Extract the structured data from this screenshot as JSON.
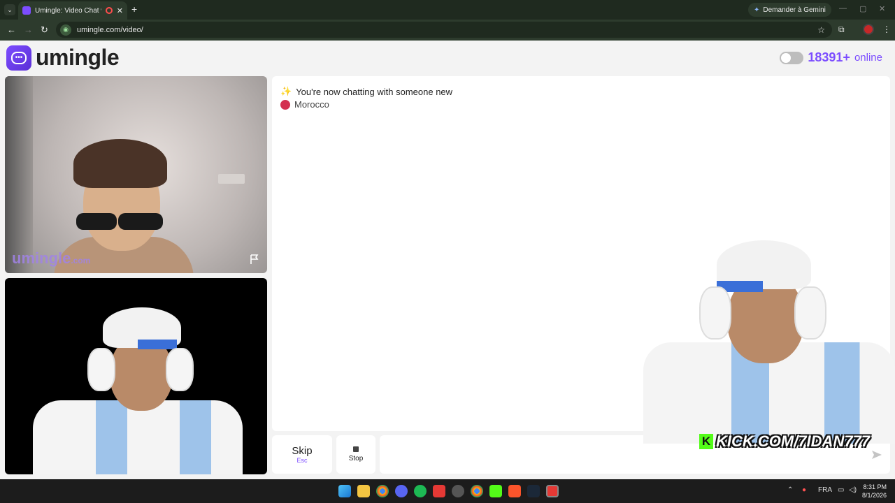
{
  "browser": {
    "tab_title": "Umingle: Video Chat with S",
    "new_tab_symbol": "+",
    "gemini_label": "Demander à Gemini",
    "url": "umingle.com/video/"
  },
  "header": {
    "logo_text": "umingle",
    "online_count": "18391+",
    "online_label": "online"
  },
  "video": {
    "watermark_main": "umingle",
    "watermark_suffix": ".com"
  },
  "chat": {
    "status_message": "You're now chatting with someone new",
    "country": "Morocco",
    "country_flag_color": "#d32f4f",
    "input_placeholder": ""
  },
  "controls": {
    "skip_label": "Skip",
    "skip_key": "Esc",
    "stop_label": "Stop"
  },
  "stream_overlay": {
    "kick_logo": "K",
    "kick_text": "KICK.COM/7IDAN777"
  },
  "taskbar": {
    "language": "FRA",
    "time": "8:31 PM",
    "date": "8/1/2026"
  },
  "colors": {
    "accent": "#7c4dff",
    "kick_green": "#53fc18"
  }
}
